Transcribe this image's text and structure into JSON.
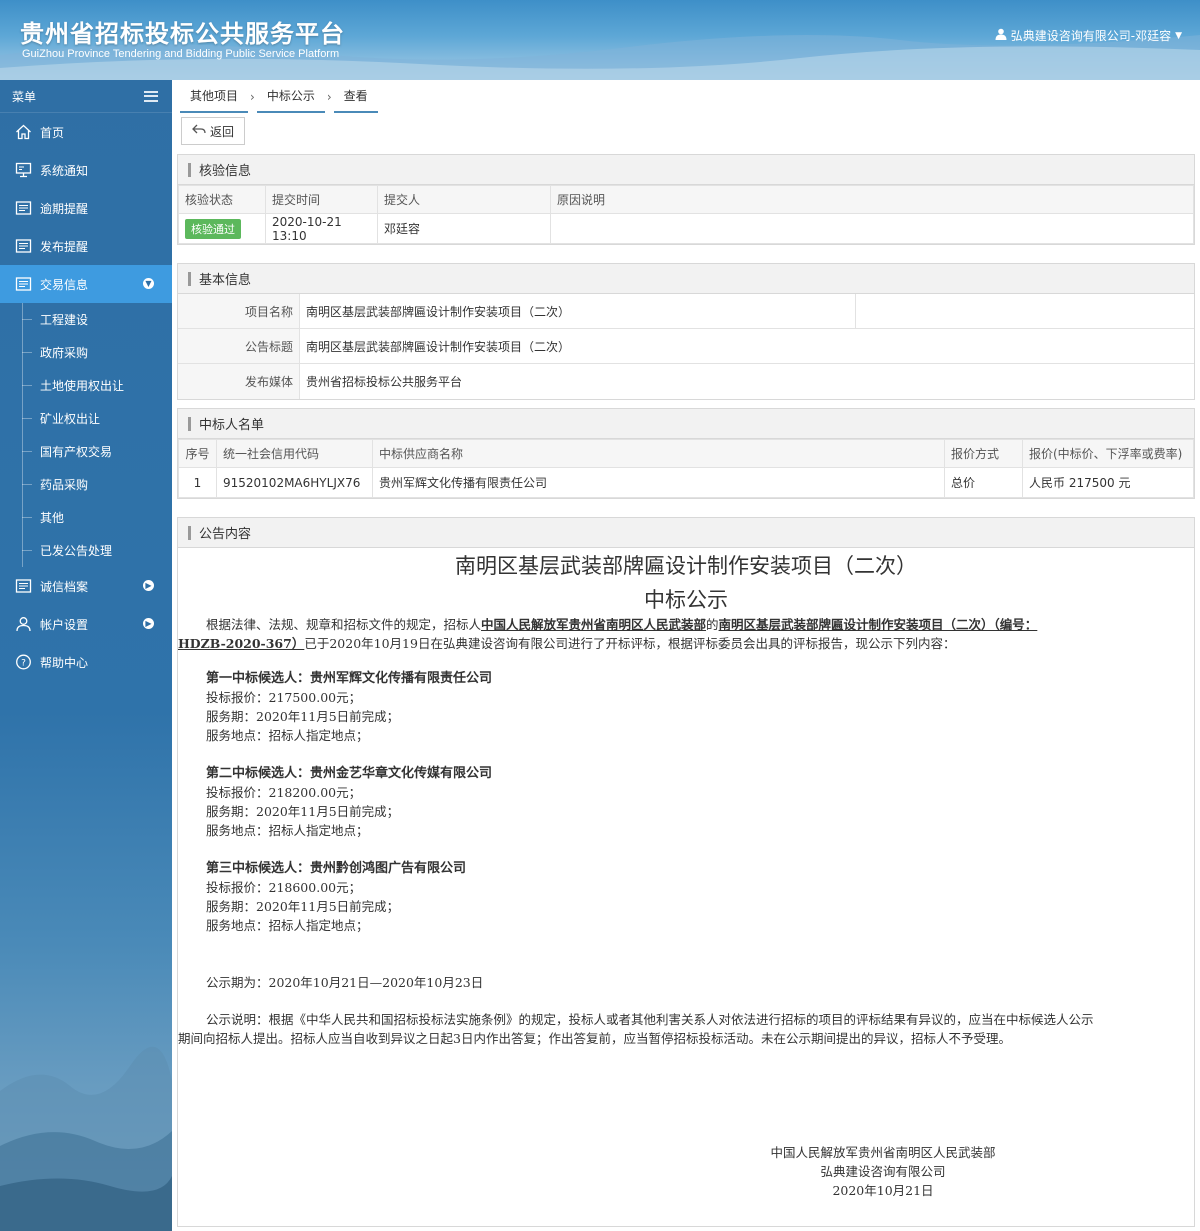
{
  "header": {
    "title": "贵州省招标投标公共服务平台",
    "subtitle": "GuiZhou Province Tendering and Bidding Public Service Platform",
    "user": "弘典建设咨询有限公司-邓廷容"
  },
  "sidebar": {
    "menu_label": "菜单",
    "items": [
      {
        "label": "首页",
        "icon": "home-icon"
      },
      {
        "label": "系统通知",
        "icon": "monitor-icon"
      },
      {
        "label": "逾期提醒",
        "icon": "list-icon"
      },
      {
        "label": "发布提醒",
        "icon": "list-icon"
      },
      {
        "label": "交易信息",
        "icon": "list-icon"
      }
    ],
    "sub_items": [
      "工程建设",
      "政府采购",
      "土地使用权出让",
      "矿业权出让",
      "国有产权交易",
      "药品采购",
      "其他",
      "已发公告处理"
    ],
    "lower_items": [
      {
        "label": "诚信档案",
        "icon": "list-icon"
      },
      {
        "label": "帐户设置",
        "icon": "user-icon"
      },
      {
        "label": "帮助中心",
        "icon": "help-icon"
      }
    ]
  },
  "breadcrumb": [
    "其他项目",
    "中标公示",
    "查看"
  ],
  "back_label": "返回",
  "verify": {
    "title": "核验信息",
    "headers": [
      "核验状态",
      "提交时间",
      "提交人",
      "原因说明"
    ],
    "status": "核验通过",
    "time": "2020-10-21 13:10",
    "submitter": "邓廷容",
    "reason": ""
  },
  "basic": {
    "title": "基本信息",
    "rows": [
      {
        "label": "项目名称",
        "value": "南明区基层武装部牌匾设计制作安装项目（二次）"
      },
      {
        "label": "公告标题",
        "value": "南明区基层武装部牌匾设计制作安装项目（二次）"
      },
      {
        "label": "发布媒体",
        "value": "贵州省招标投标公共服务平台"
      }
    ]
  },
  "winners": {
    "title": "中标人名单",
    "headers": [
      "序号",
      "统一社会信用代码",
      "中标供应商名称",
      "报价方式",
      "报价(中标价、下浮率或费率)"
    ],
    "rows": [
      {
        "no": "1",
        "code": "91520102MA6HYLJX76",
        "name": "贵州军辉文化传播有限责任公司",
        "method": "总价",
        "price": "人民币 217500 元"
      }
    ]
  },
  "notice": {
    "title": "公告内容",
    "heading1": "南明区基层武装部牌匾设计制作安装项目（二次）",
    "heading2": "中标公示",
    "intro_a": "根据法律、法规、规章和招标文件的规定，招标人",
    "tenderer": "中国人民解放军贵州省南明区人民武装部",
    "intro_b": "的",
    "project_a": "南明区基层武装部牌匾设计制作安装项目（二次）（编号：",
    "project_b": "HDZB-2020-367）",
    "intro_c": "已于2020年10月19日在弘典建设咨询有限公司进行了开标评标，根据评标委员会出具的评标报告，现公示下列内容：",
    "candidates": [
      {
        "title": "第一中标候选人：贵州军辉文化传播有限责任公司",
        "price": "投标报价：217500.00元；",
        "period": "服务期：2020年11月5日前完成；",
        "place": "服务地点：招标人指定地点；"
      },
      {
        "title": "第二中标候选人：贵州金艺华章文化传媒有限公司",
        "price": "投标报价：218200.00元；",
        "period": "服务期：2020年11月5日前完成；",
        "place": "服务地点：招标人指定地点；"
      },
      {
        "title": "第三中标候选人：贵州黔创鸿图广告有限公司",
        "price": "投标报价：218600.00元；",
        "period": "服务期：2020年11月5日前完成；",
        "place": "服务地点：招标人指定地点；"
      }
    ],
    "period": "公示期为：2020年10月21日—2020年10月23日",
    "explain_1": "公示说明：根据《中华人民共和国招标投标法实施条例》的规定，投标人或者其他利害关系人对依法进行招标的项目的评标结果有异议的，应当在中标候选人公示",
    "explain_2": "期间向招标人提出。招标人应当自收到异议之日起3日内作出答复；作出答复前，应当暂停招标投标活动。未在公示期间提出的异议，招标人不予受理。",
    "sign_1": "中国人民解放军贵州省南明区人民武装部",
    "sign_2": "弘典建设咨询有限公司",
    "sign_date": "2020年10月21日"
  }
}
